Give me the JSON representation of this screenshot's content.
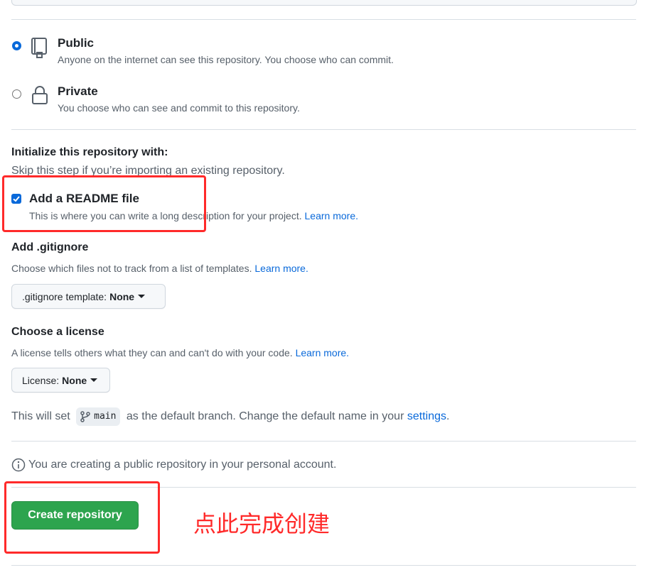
{
  "visibility": {
    "public": {
      "title": "Public",
      "description": "Anyone on the internet can see this repository. You choose who can commit.",
      "selected": true
    },
    "private": {
      "title": "Private",
      "description": "You choose who can see and commit to this repository.",
      "selected": false
    }
  },
  "initialize": {
    "title": "Initialize this repository with:",
    "skip_note": "Skip this step if you’re importing an existing repository.",
    "readme": {
      "label": "Add a README file",
      "description": "This is where you can write a long description for your project.",
      "learn_more": "Learn more.",
      "checked": true
    }
  },
  "gitignore": {
    "title": "Add .gitignore",
    "description": "Choose which files not to track from a list of templates.",
    "learn_more": "Learn more.",
    "button_prefix": ".gitignore template:",
    "button_value": "None"
  },
  "license": {
    "title": "Choose a license",
    "description": "A license tells others what they can and can't do with your code.",
    "learn_more": "Learn more.",
    "button_prefix": "License:",
    "button_value": "None"
  },
  "default_branch": {
    "prefix": "This will set",
    "branch": "main",
    "middle": "as the default branch. Change the default name in your",
    "settings_link": "settings",
    "suffix": "."
  },
  "notice": "You are creating a public repository in your personal account.",
  "create_button": "Create repository",
  "annotation": "点此完成创建",
  "colors": {
    "accent": "#0969da",
    "create_green": "#2da44e",
    "annotation_red": "#ff2a2a"
  }
}
